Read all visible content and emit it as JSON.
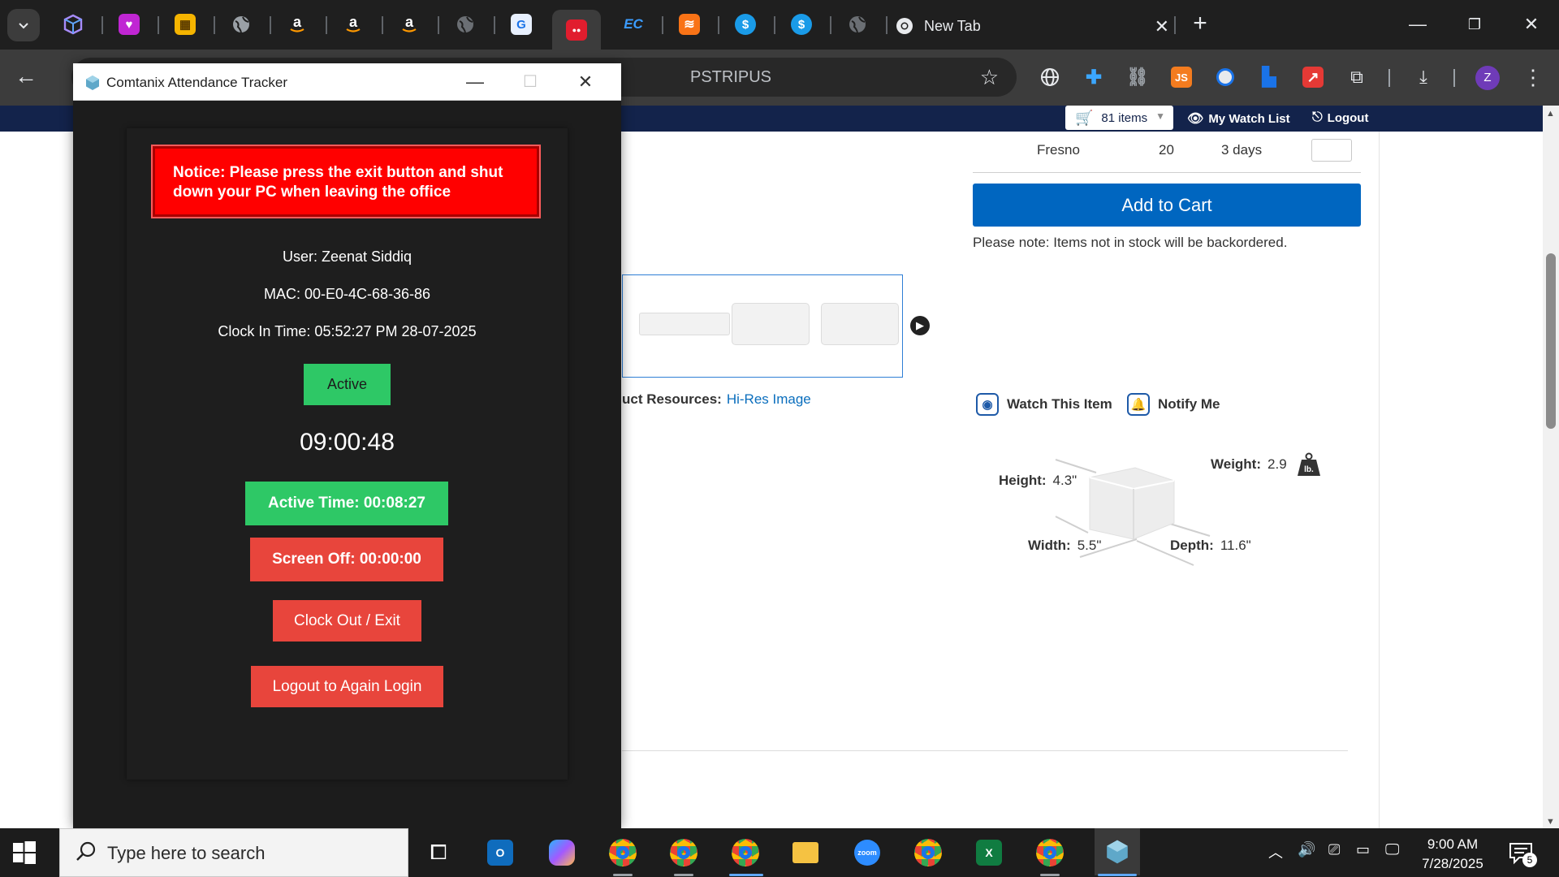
{
  "browser": {
    "active_tab_title": "New Tab",
    "new_tab_plus": "+",
    "omnibox_text": "PSTRIPUS",
    "profile_initial": "Z"
  },
  "site": {
    "cart_label": "81 items",
    "watch_list_label": "My Watch List",
    "logout_label": "Logout",
    "stock_row": {
      "location": "Fresno",
      "quantity": "20",
      "lead_time": "3 days"
    },
    "add_to_cart_label": "Add to Cart",
    "stock_note": "Please note: Items not in stock will be backordered.",
    "resources_label": "uct Resources:",
    "hires_link": "Hi-Res Image",
    "watch_item_label": "Watch This Item",
    "notify_label": "Notify Me",
    "dimensions": {
      "height_label": "Height:",
      "height_value": "4.3\"",
      "width_label": "Width:",
      "width_value": "5.5\"",
      "depth_label": "Depth:",
      "depth_value": "11.6\"",
      "weight_label": "Weight:",
      "weight_value": "2.9",
      "weight_unit": "lb."
    }
  },
  "tracker": {
    "window_title": "Comtanix Attendance Tracker",
    "notice": "Notice: Please press the exit button and shut down your PC when leaving the office",
    "user": "User: Zeenat Siddiq",
    "mac": "MAC: 00-E0-4C-68-36-86",
    "clock_in": "Clock In Time: 05:52:27 PM 28-07-2025",
    "status": "Active",
    "clock": "09:00:48",
    "active_time": "Active Time: 00:08:27",
    "screen_off": "Screen Off: 00:00:00",
    "clock_out_label": "Clock Out / Exit",
    "relogin_label": "Logout to Again Login"
  },
  "taskbar": {
    "search_placeholder": "Type here to search",
    "time": "9:00 AM",
    "date": "7/28/2025",
    "notification_count": "5",
    "zoom_label": "zoom",
    "excel_label": "X"
  },
  "colors": {
    "notice_red": "#ff0000",
    "active_green": "#2ec866",
    "button_red": "#e8453c",
    "add_cart_blue": "#0066c0",
    "site_navy": "#13234b"
  }
}
